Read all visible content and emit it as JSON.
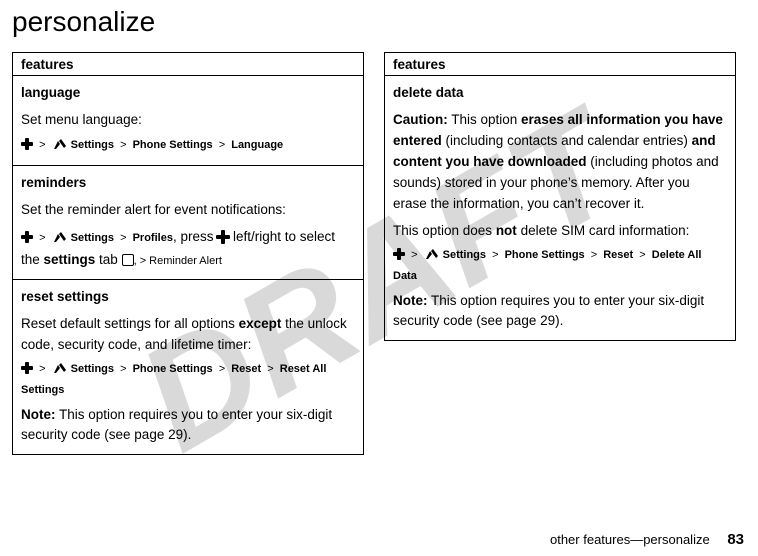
{
  "watermark": "DRAFT",
  "title": "personalize",
  "left": {
    "header": "features",
    "rows": [
      {
        "head": "language",
        "desc": "Set menu language:",
        "path": {
          "s": "Settings",
          "p1": "Phone Settings",
          "p2": "Language"
        }
      },
      {
        "head": "reminders",
        "desc": "Set the reminder alert for event notifications:",
        "path2": {
          "s": "Settings",
          "pr": "Profiles",
          "mid1": ", press ",
          "mid2": " left/right to select the ",
          "tab": "settings",
          "mid3": " tab ",
          "end": ", > ",
          "ra": "Reminder Alert"
        }
      },
      {
        "head": "reset settings",
        "desc1a": "Reset default settings for all options ",
        "desc1b": "except",
        "desc1c": " the unlock code, security code, and lifetime timer:",
        "path": {
          "s": "Settings",
          "p1": "Phone Settings",
          "p2": "Reset",
          "p3": "Reset All Settings"
        },
        "noteLabel": "Note:",
        "noteText": " This option requires you to enter your six-digit security code (see page 29)."
      }
    ]
  },
  "right": {
    "header": "features",
    "row": {
      "head": "delete data",
      "cautionLabel": "Caution:",
      "c1": " This option ",
      "c2": "erases all information you have entered",
      "c3": " (including contacts and calendar entries) ",
      "c4": "and content you have downloaded",
      "c5": " (including photos and sounds) stored in your phone’s memory. After you erase the information, you can’t recover it.",
      "p2a": "This option does ",
      "p2b": "not",
      "p2c": " delete SIM card information:",
      "path": {
        "s": "Settings",
        "p1": "Phone Settings",
        "p2": "Reset",
        "p3": "Delete All Data"
      },
      "noteLabel": "Note:",
      "noteText": " This option requires you to enter your six-digit security code (see page 29)."
    }
  },
  "footer": {
    "text": "other features—personalize",
    "page": "83"
  },
  "gt": ">"
}
